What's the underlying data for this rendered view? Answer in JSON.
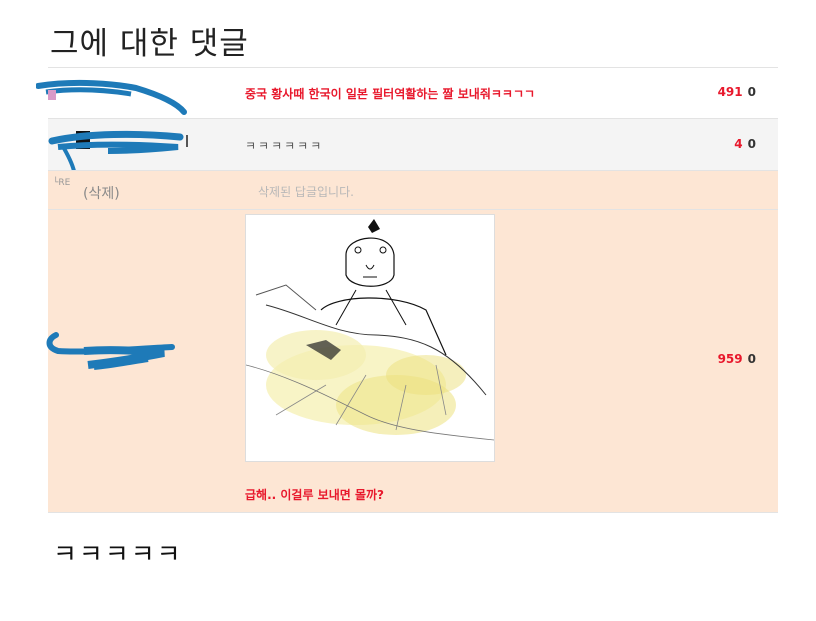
{
  "page": {
    "heading": "그에 대한 댓글",
    "footer_text": "ㅋㅋㅋㅋㅋ"
  },
  "comments": [
    {
      "text": "중국 황사때 한국이 일본 필터역활하는 짤 보내줘ㅋㅋㄱㄱ",
      "up": "491",
      "down": "0",
      "style": "hot"
    },
    {
      "text": "ㅋㅋㅋㅋㅋㅋ",
      "up": "4",
      "down": "0",
      "style": "plain"
    },
    {
      "re_label": "└RE",
      "nick": "(삭제)",
      "text": "삭제된 답글입니다.",
      "style": "deleted"
    },
    {
      "text": "급해.. 이걸루 보내면 몰까?",
      "up": "959",
      "down": "0",
      "style": "hot",
      "image": "sketch-drawing"
    }
  ],
  "colors": {
    "accent": "#e8182c",
    "reply_bg": "#fde6d4",
    "scribble": "#1e7ab8"
  }
}
